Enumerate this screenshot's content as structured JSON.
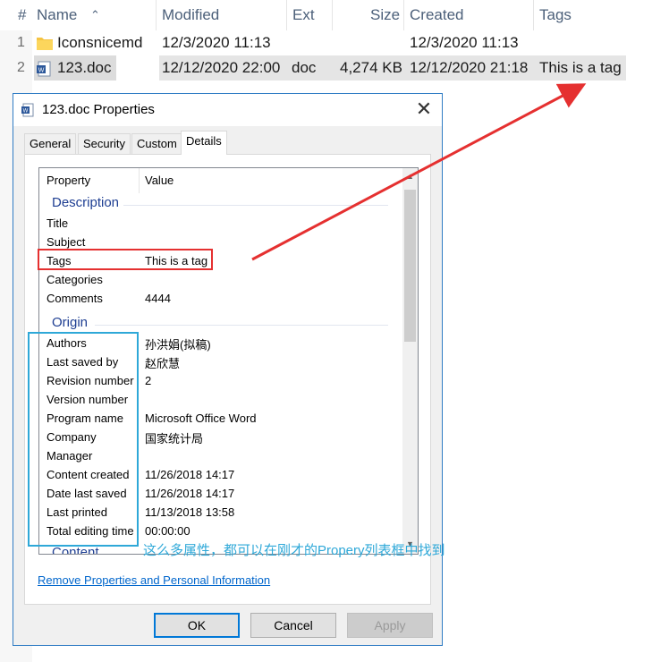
{
  "explorer": {
    "columns": {
      "hash": "#",
      "name": "Name",
      "modified": "Modified",
      "ext": "Ext",
      "size": "Size",
      "created": "Created",
      "tags": "Tags"
    },
    "rows": [
      {
        "num": "1",
        "name": "Iconsnicemd",
        "modified": "12/3/2020 11:13",
        "ext": "",
        "size": "",
        "created": "12/3/2020 11:13",
        "tags": "",
        "icon": "folder-icon"
      },
      {
        "num": "2",
        "name": "123.doc",
        "modified": "12/12/2020 22:00",
        "ext": "doc",
        "size": "4,274 KB",
        "created": "12/12/2020 21:18",
        "tags": "This is a tag",
        "icon": "word-doc-icon"
      }
    ]
  },
  "dialog": {
    "title": "123.doc Properties",
    "tabs": [
      "General",
      "Security",
      "Custom",
      "Details"
    ],
    "active_tab": "Details",
    "list_header": {
      "property": "Property",
      "value": "Value"
    },
    "groups": {
      "description": "Description",
      "origin": "Origin",
      "content": "Content"
    },
    "description_props": [
      {
        "name": "Title",
        "value": ""
      },
      {
        "name": "Subject",
        "value": ""
      },
      {
        "name": "Tags",
        "value": "This is a tag"
      },
      {
        "name": "Categories",
        "value": ""
      },
      {
        "name": "Comments",
        "value": "4444"
      }
    ],
    "origin_props": [
      {
        "name": "Authors",
        "value": "孙洪娟(拟稿)"
      },
      {
        "name": "Last saved by",
        "value": "赵欣慧"
      },
      {
        "name": "Revision number",
        "value": "2"
      },
      {
        "name": "Version number",
        "value": ""
      },
      {
        "name": "Program name",
        "value": "Microsoft Office Word"
      },
      {
        "name": "Company",
        "value": "国家统计局"
      },
      {
        "name": "Manager",
        "value": ""
      },
      {
        "name": "Content created",
        "value": "11/26/2018 14:17"
      },
      {
        "name": "Date last saved",
        "value": "11/26/2018 14:17"
      },
      {
        "name": "Last printed",
        "value": "11/13/2018 13:58"
      },
      {
        "name": "Total editing time",
        "value": "00:00:00"
      }
    ],
    "remove_link": "Remove Properties and Personal Information",
    "buttons": {
      "ok": "OK",
      "cancel": "Cancel",
      "apply": "Apply"
    }
  },
  "annotation": {
    "text": "这么多属性，都可以在刚才的Propery列表框中找到",
    "red_color": "#e53030",
    "blue_color": "#2ea8d8"
  }
}
